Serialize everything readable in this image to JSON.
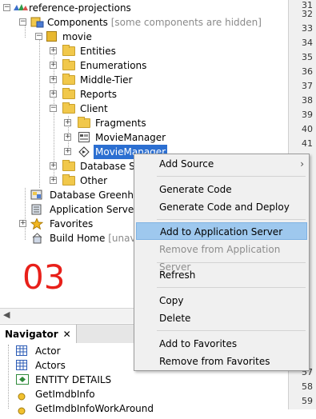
{
  "tree": {
    "root": {
      "label": "reference-projections"
    },
    "components": {
      "label": "Components",
      "hint": "[some components are hidden]"
    },
    "movie": {
      "label": "movie"
    },
    "items": [
      {
        "label": "Entities"
      },
      {
        "label": "Enumerations"
      },
      {
        "label": "Middle-Tier"
      },
      {
        "label": "Reports"
      },
      {
        "label": "Client"
      }
    ],
    "client_children": [
      {
        "label": "Fragments"
      },
      {
        "label": "MovieManager"
      },
      {
        "label": "MovieManager"
      }
    ],
    "after": [
      {
        "label": "Database Se"
      },
      {
        "label": "Other"
      }
    ],
    "top_level": [
      {
        "label": "Database Greenho"
      },
      {
        "label": "Application Server"
      },
      {
        "label": "Favorites"
      },
      {
        "label": "Build Home",
        "hint": "[unava"
      }
    ]
  },
  "overlay_label": "03",
  "gutter": {
    "lines": [
      "31",
      "32",
      "33",
      "34",
      "35",
      "36",
      "37",
      "38",
      "39",
      "40",
      "41"
    ],
    "bottom_lines": [
      "57",
      "58",
      "59"
    ]
  },
  "navigator": {
    "tab_label": "Navigator",
    "close_glyph": "✕",
    "items": [
      {
        "label": "Actor"
      },
      {
        "label": "Actors"
      },
      {
        "label": "ENTITY DETAILS"
      },
      {
        "label": "GetImdbInfo"
      },
      {
        "label": "GetImdbInfoWorkAround"
      }
    ]
  },
  "context_menu": {
    "items": [
      {
        "label": "Add Source",
        "submenu": true
      },
      {
        "label": "Generate Code"
      },
      {
        "label": "Generate Code and Deploy"
      },
      {
        "label": "Add to Application Server",
        "highlighted": true
      },
      {
        "label": "Remove from Application Server",
        "disabled": true
      },
      {
        "label": "Refresh"
      },
      {
        "label": "Copy"
      },
      {
        "label": "Delete"
      },
      {
        "label": "Add to Favorites"
      },
      {
        "label": "Remove from Favorites"
      }
    ],
    "submenu_glyph": "›"
  },
  "colors": {
    "selection": "#2c6fd1",
    "menu_highlight": "#9ec8ee",
    "overlay_label": "#e8201a"
  }
}
